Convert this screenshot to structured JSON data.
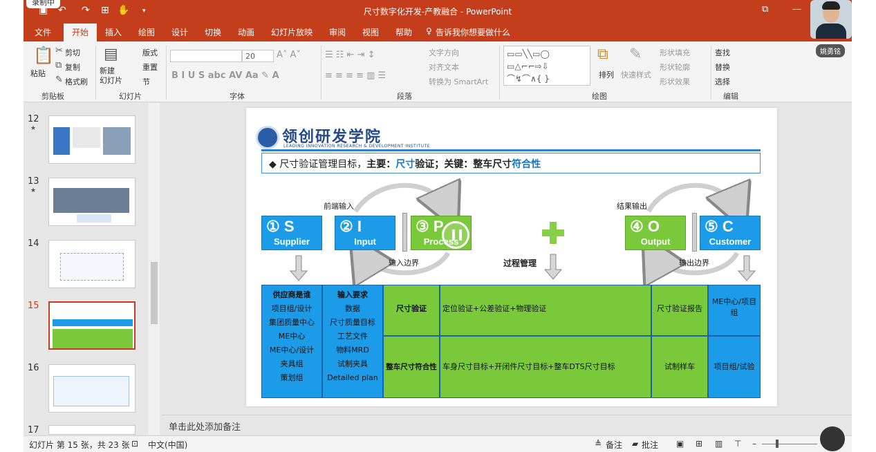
{
  "recording_badge": "录制中",
  "window_title": "尺寸数字化开发-产教融合 - PowerPoint",
  "tabs": [
    "文件",
    "开始",
    "插入",
    "绘图",
    "设计",
    "切换",
    "动画",
    "幻灯片放映",
    "审阅",
    "视图",
    "帮助"
  ],
  "tell_me": "告诉我你想要做什么",
  "ribbon": {
    "clipboard": {
      "paste": "粘贴",
      "cut": "剪切",
      "copy": "复制",
      "format_painter": "格式刷",
      "label": "剪贴板"
    },
    "slides": {
      "new_slide": "新建\n幻灯片",
      "layout": "版式",
      "reset": "重置",
      "section": "节",
      "label": "幻灯片"
    },
    "font": {
      "size": "20",
      "label": "字体"
    },
    "paragraph": {
      "text_direction": "文字方向",
      "align_text": "对齐文本",
      "smartart": "转换为 SmartArt",
      "label": "段落"
    },
    "drawing": {
      "arrange": "排列",
      "quick_styles": "快速样式",
      "shape_fill": "形状填充",
      "shape_outline": "形状轮廓",
      "shape_effects": "形状效果",
      "label": "绘图"
    },
    "editing": {
      "find": "查找",
      "replace": "替换",
      "select": "选择",
      "label": "编辑"
    }
  },
  "thumbnails": [
    {
      "num": "12",
      "star": true
    },
    {
      "num": "13",
      "star": true
    },
    {
      "num": "14",
      "star": false
    },
    {
      "num": "15",
      "star": false,
      "selected": true
    },
    {
      "num": "16",
      "star": false
    },
    {
      "num": "17",
      "star": false
    }
  ],
  "slide": {
    "logo_title": "领创研发学院",
    "logo_sub": "LEADING INNOVATION RESEARCH & DEVELOPMENT INSTITUTE",
    "objective": {
      "prefix": "◆ 尺寸验证管理目标，",
      "main_label": "主要：",
      "main_value": "尺寸",
      "main_suffix": "验证；",
      "key_label": "关键：",
      "key_value": "整车尺寸",
      "key_suffix": "符合性"
    },
    "boxes": [
      {
        "num": "① S",
        "sub": "Supplier"
      },
      {
        "num": "② I",
        "sub": "Input"
      },
      {
        "num": "③ P",
        "sub": "Process"
      },
      {
        "num": "④ O",
        "sub": "Output"
      },
      {
        "num": "⑤ C",
        "sub": "Customer"
      }
    ],
    "labels": {
      "front_input": "前端输入",
      "input_boundary": "输入边界",
      "process_mgmt": "过程管理",
      "result_output": "结果输出",
      "output_boundary": "输出边界"
    },
    "table": {
      "supplier": [
        "供应商是谁",
        "项目组/设计",
        "集团质量中心",
        "ME中心",
        "ME中心/设计",
        "夹具组",
        "策划组"
      ],
      "input": [
        "输入要求",
        "数据",
        "尺寸质量目标",
        "工艺文件",
        "物料MRD",
        "试制夹具",
        "Detailed plan"
      ],
      "row1": {
        "process": "尺寸验证",
        "detail": "定位验证+公差验证+物理验证",
        "output": "尺寸验证报告",
        "customer": "ME中心/项目组"
      },
      "row2": {
        "process": "整车尺寸符合性",
        "detail": "车身尺寸目标+开闭件尺寸目标+整车DTS尺寸目标",
        "output": "试制样车",
        "customer": "项目组/试验"
      }
    }
  },
  "notes_placeholder": "单击此处添加备注",
  "status": {
    "slide_info": "幻灯片 第 15 张，共 23 张",
    "language": "中文(中国)",
    "notes": "备注",
    "comments": "批注"
  },
  "presenter_name": "姚勇铭",
  "colors": {
    "accent": "#c43e1c",
    "blue_box": "#1c9ce8",
    "green_box": "#79c93a"
  }
}
